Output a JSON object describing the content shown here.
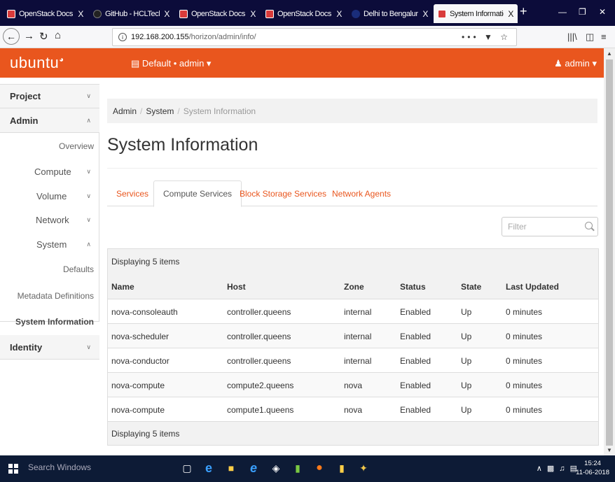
{
  "browser": {
    "tabs": [
      {
        "label": "OpenStack Docs: Etcd for",
        "icon": "openstack-icon"
      },
      {
        "label": "GitHub - HCLTech-SSW/",
        "icon": "github-icon"
      },
      {
        "label": "OpenStack Docs: Verify C",
        "icon": "openstack-icon"
      },
      {
        "label": "OpenStack Docs: Install a",
        "icon": "openstack-icon"
      },
      {
        "label": "Delhi to Bengaluru Flight",
        "icon": "flight-icon"
      },
      {
        "label": "System Information - Op",
        "icon": "openstack-icon"
      }
    ],
    "tab_close": "X",
    "url_host": "192.168.200.155",
    "url_path": "/horizon/admin/info/",
    "url_menu": "•••"
  },
  "header": {
    "logo": "ubuntu",
    "project": "Default • admin",
    "user": "admin"
  },
  "sidebar": {
    "project": "Project",
    "admin": "Admin",
    "overview": "Overview",
    "compute": "Compute",
    "volume": "Volume",
    "network": "Network",
    "system": "System",
    "defaults": "Defaults",
    "metadata": "Metadata Definitions",
    "system_information": "System Information",
    "identity": "Identity"
  },
  "breadcrumb": {
    "admin": "Admin",
    "system": "System",
    "current": "System Information"
  },
  "page_title": "System Information",
  "tabs": [
    "Services",
    "Compute Services",
    "Block Storage Services",
    "Network Agents"
  ],
  "active_tab": "Compute Services",
  "filter_placeholder": "Filter",
  "table": {
    "caption": "Displaying 5 items",
    "footer": "Displaying 5 items",
    "headers": [
      "Name",
      "Host",
      "Zone",
      "Status",
      "State",
      "Last Updated"
    ],
    "rows": [
      [
        "nova-consoleauth",
        "controller.queens",
        "internal",
        "Enabled",
        "Up",
        "0 minutes"
      ],
      [
        "nova-scheduler",
        "controller.queens",
        "internal",
        "Enabled",
        "Up",
        "0 minutes"
      ],
      [
        "nova-conductor",
        "controller.queens",
        "internal",
        "Enabled",
        "Up",
        "0 minutes"
      ],
      [
        "nova-compute",
        "compute2.queens",
        "nova",
        "Enabled",
        "Up",
        "0 minutes"
      ],
      [
        "nova-compute",
        "compute1.queens",
        "nova",
        "Enabled",
        "Up",
        "0 minutes"
      ]
    ]
  },
  "taskbar": {
    "search": "Search Windows",
    "time": "15:24",
    "date": "11-06-2018"
  },
  "colors": {
    "accent": "#e9561e",
    "tabstrip": "#0c0c3a",
    "taskbar": "#0d1b36"
  }
}
